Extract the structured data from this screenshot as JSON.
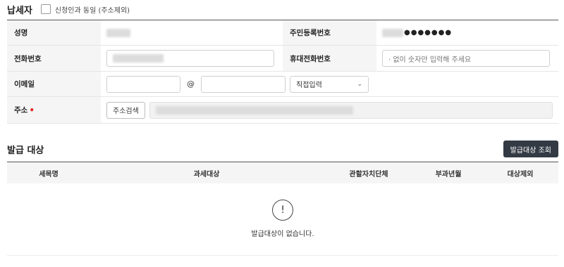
{
  "taxpayer": {
    "title": "납세자",
    "same_as_applicant_label": "신청인과 동일 (주소제외)"
  },
  "form": {
    "name_label": "성명",
    "rrn_label": "주민등록번호",
    "rrn_masked": "●●●●●●●",
    "phone_label": "전화번호",
    "mobile_label": "휴대전화번호",
    "mobile_placeholder": "· 없이 숫자만 입력해 주세요",
    "email_label": "이메일",
    "email_at": "@",
    "email_domain_select": "직접입력",
    "address_label": "주소",
    "required_mark": "•",
    "address_search_button": "주소검색"
  },
  "issue": {
    "title": "발급 대상",
    "lookup_button": "발급대상 조회",
    "columns": [
      "세목명",
      "과세대상",
      "관할자치단체",
      "부과년월",
      "대상제외"
    ],
    "empty_message": "발급대상이 없습니다.",
    "empty_icon": "!"
  }
}
